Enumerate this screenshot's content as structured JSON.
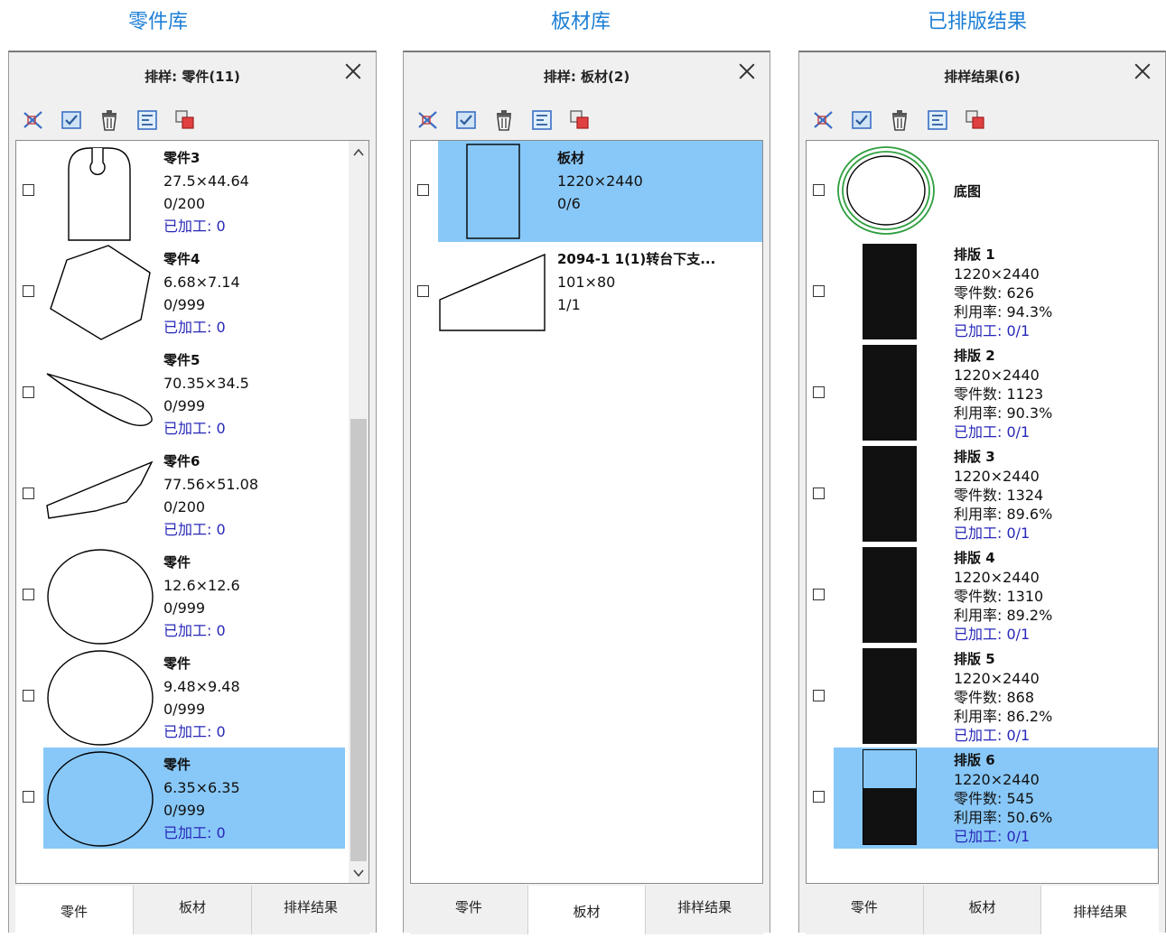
{
  "captions": [
    "零件库",
    "板材库",
    "已排版结果"
  ],
  "parts_panel": {
    "title": "排样: 零件(11)",
    "items": [
      {
        "name": "零件3",
        "size": "27.5×44.64",
        "count": "0/200",
        "processed": "已加工: 0"
      },
      {
        "name": "零件4",
        "size": "6.68×7.14",
        "count": "0/999",
        "processed": "已加工: 0"
      },
      {
        "name": "零件5",
        "size": "70.35×34.5",
        "count": "0/999",
        "processed": "已加工: 0"
      },
      {
        "name": "零件6",
        "size": "77.56×51.08",
        "count": "0/200",
        "processed": "已加工: 0"
      },
      {
        "name": "零件",
        "size": "12.6×12.6",
        "count": "0/999",
        "processed": "已加工: 0"
      },
      {
        "name": "零件",
        "size": "9.48×9.48",
        "count": "0/999",
        "processed": "已加工: 0"
      },
      {
        "name": "零件",
        "size": "6.35×6.35",
        "count": "0/999",
        "processed": "已加工: 0"
      }
    ],
    "tabs": [
      "零件",
      "板材",
      "排样结果"
    ],
    "active_tab": "零件"
  },
  "sheets_panel": {
    "title": "排样: 板材(2)",
    "items": [
      {
        "name": "板材",
        "size": "1220×2440",
        "count": "0/6"
      },
      {
        "name": "2094-1 1(1)转台下支...",
        "size": "101×80",
        "count": "1/1"
      }
    ],
    "tabs": [
      "零件",
      "板材",
      "排样结果"
    ],
    "active_tab": "板材"
  },
  "results_panel": {
    "title": "排样结果(6)",
    "base_label": "底图",
    "items": [
      {
        "name": "排版 1",
        "size": "1220×2440",
        "parts": "零件数: 626",
        "util": "利用率: 94.3%",
        "processed": "已加工: 0/1"
      },
      {
        "name": "排版 2",
        "size": "1220×2440",
        "parts": "零件数: 1123",
        "util": "利用率: 90.3%",
        "processed": "已加工: 0/1"
      },
      {
        "name": "排版 3",
        "size": "1220×2440",
        "parts": "零件数: 1324",
        "util": "利用率: 89.6%",
        "processed": "已加工: 0/1"
      },
      {
        "name": "排版 4",
        "size": "1220×2440",
        "parts": "零件数: 1310",
        "util": "利用率: 89.2%",
        "processed": "已加工: 0/1"
      },
      {
        "name": "排版 5",
        "size": "1220×2440",
        "parts": "零件数: 868",
        "util": "利用率: 86.2%",
        "processed": "已加工: 0/1"
      },
      {
        "name": "排版 6",
        "size": "1220×2440",
        "parts": "零件数: 545",
        "util": "利用率: 50.6%",
        "processed": "已加工: 0/1"
      }
    ],
    "tabs": [
      "零件",
      "板材",
      "排样结果"
    ],
    "active_tab": "排样结果"
  },
  "colors": {
    "caption": "#1d7fd6",
    "selection": "#88c8f8",
    "processed_text": "#2727b8",
    "base_ring": "#2e9e3e"
  },
  "toolbar_icons": [
    "nest-icon",
    "select-all-icon",
    "delete-icon",
    "arrange-icon",
    "copy-icon"
  ]
}
